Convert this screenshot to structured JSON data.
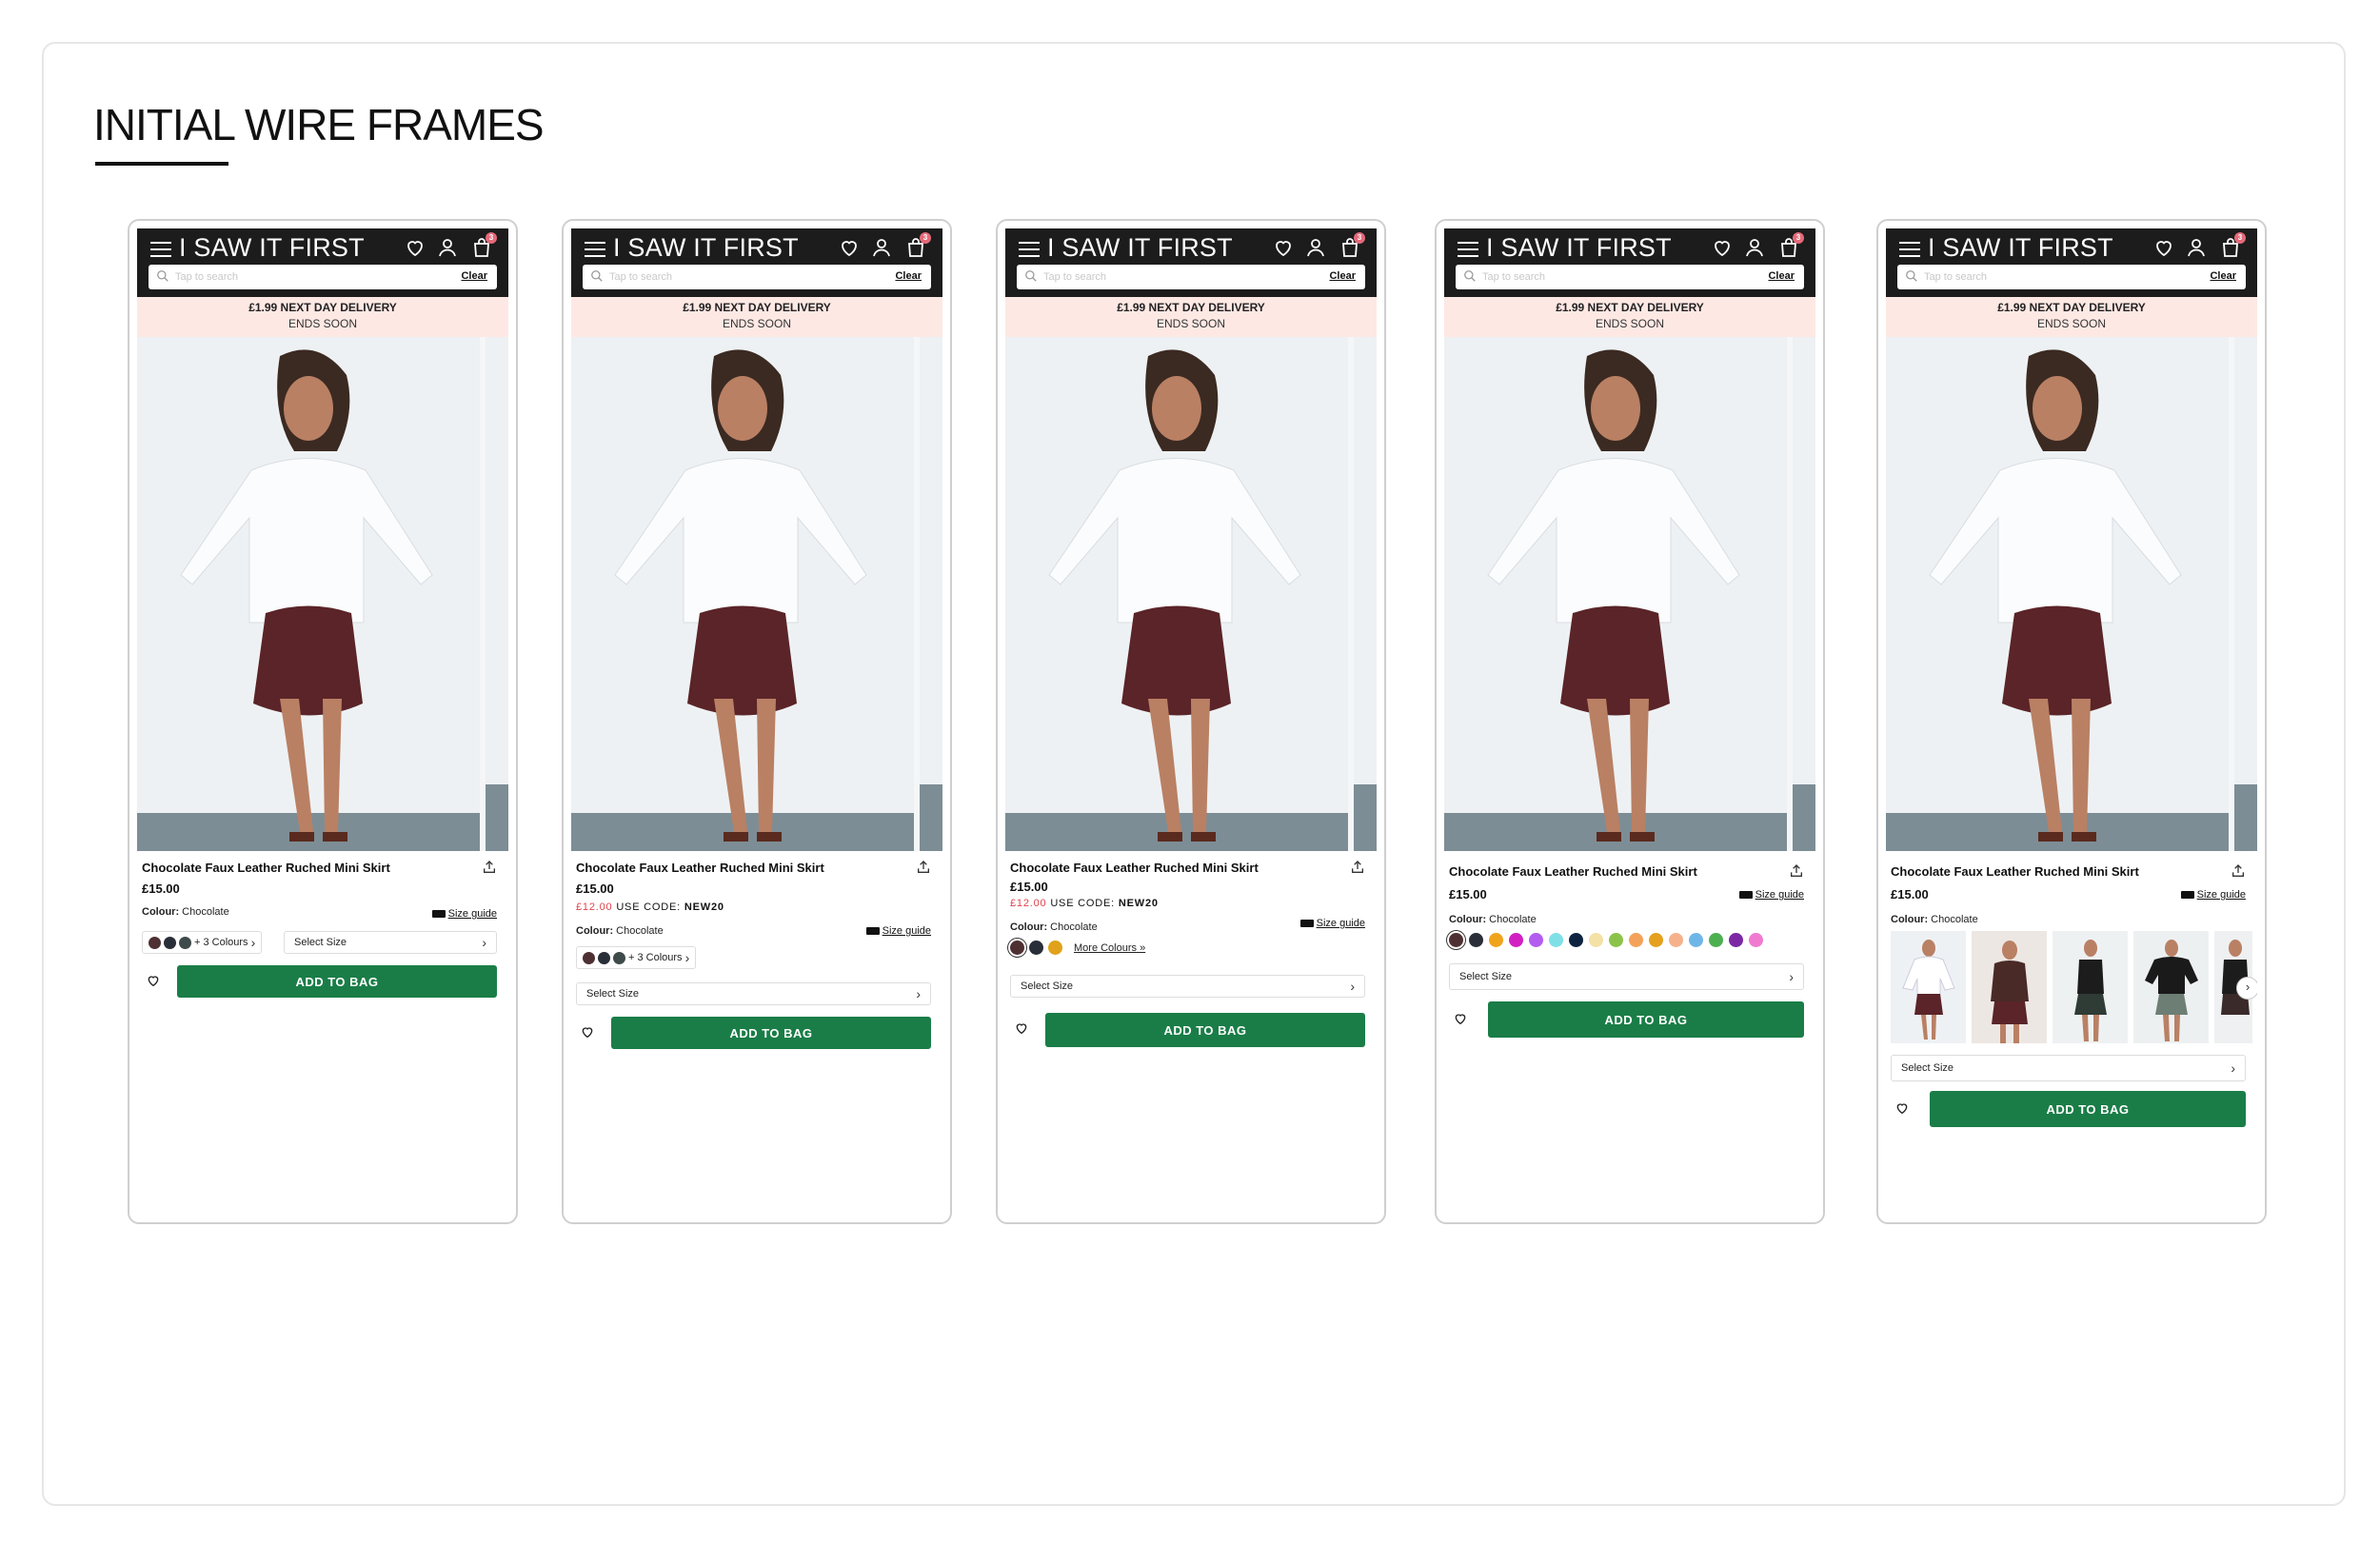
{
  "page": {
    "title": "INITIAL WIRE FRAMES"
  },
  "header": {
    "logo": "I SAW IT FIRST",
    "cart_count": "3",
    "search_placeholder": "Tap to search",
    "clear_label": "Clear"
  },
  "promo": {
    "title": "£1.99 NEXT DAY DELIVERY",
    "subtitle": "ENDS SOON"
  },
  "product": {
    "name": "Chocolate Faux Leather Ruched Mini Skirt",
    "price": "£15.00",
    "sale_price": "£12.00",
    "sale_code_label": "USE CODE:",
    "sale_code": "NEW20",
    "colour_label": "Colour:",
    "colour_value": "Chocolate",
    "size_guide": "Size guide",
    "colours_more": "+ 3 Colours",
    "more_colours_link": "More Colours",
    "select_size": "Select Size",
    "add_to_bag": "ADD TO BAG"
  },
  "colors": {
    "brand_green": "#1a7d47",
    "promo_bg": "#fde8e4",
    "header_bg": "#1c1c1c",
    "sale_red": "#e0424c",
    "swatches_short": [
      "#4e3033",
      "#2a2e38",
      "#3f4a4a"
    ],
    "swatches_v3": [
      "#4e3033",
      "#2a2e38",
      "#e0a21a"
    ],
    "swatches_full": [
      "#4e3033",
      "#2a2e38",
      "#f0a41c",
      "#d21fc2",
      "#b35cf0",
      "#7ee0e6",
      "#0e2340",
      "#f4e1a6",
      "#8bc34a",
      "#f4a25a",
      "#e4a01e",
      "#f6b18a",
      "#6fb6e8",
      "#4caf50",
      "#7c27a4",
      "#f07ad0"
    ]
  }
}
